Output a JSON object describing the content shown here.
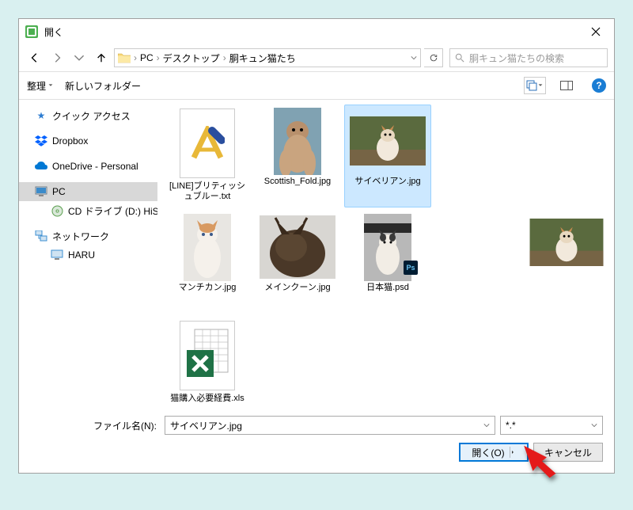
{
  "title": "開く",
  "breadcrumbs": [
    "PC",
    "デスクトップ",
    "胴キュン猫たち"
  ],
  "search_placeholder": "胴キュン猫たちの検索",
  "toolbar": {
    "organize": "整理",
    "new_folder": "新しいフォルダー"
  },
  "sidebar": {
    "quick_access": "クイック アクセス",
    "dropbox": "Dropbox",
    "onedrive": "OneDrive - Personal",
    "pc": "PC",
    "cd_drive": "CD ドライブ (D:) HiSuite",
    "network": "ネットワーク",
    "haru": "HARU"
  },
  "files": [
    {
      "name": "[LINE]ブリティッシュブルー.txt",
      "type": "txt"
    },
    {
      "name": "Scottish_Fold.jpg",
      "type": "img",
      "variant": "scottish"
    },
    {
      "name": "サイベリアン.jpg",
      "type": "img",
      "variant": "siberian",
      "selected": true
    },
    {
      "name": "マンチカン.jpg",
      "type": "img",
      "variant": "munchkin"
    },
    {
      "name": "メインクーン.jpg",
      "type": "img",
      "variant": "mainecoon"
    },
    {
      "name": "日本猫.psd",
      "type": "psd",
      "variant": "jpcat"
    },
    {
      "name": "猫購入必要経費.xls",
      "type": "xls"
    }
  ],
  "footer": {
    "filename_label": "ファイル名(N):",
    "filename_value": "サイベリアン.jpg",
    "filter_value": "*.*",
    "open_button": "開く(O)",
    "cancel_button": "キャンセル"
  }
}
